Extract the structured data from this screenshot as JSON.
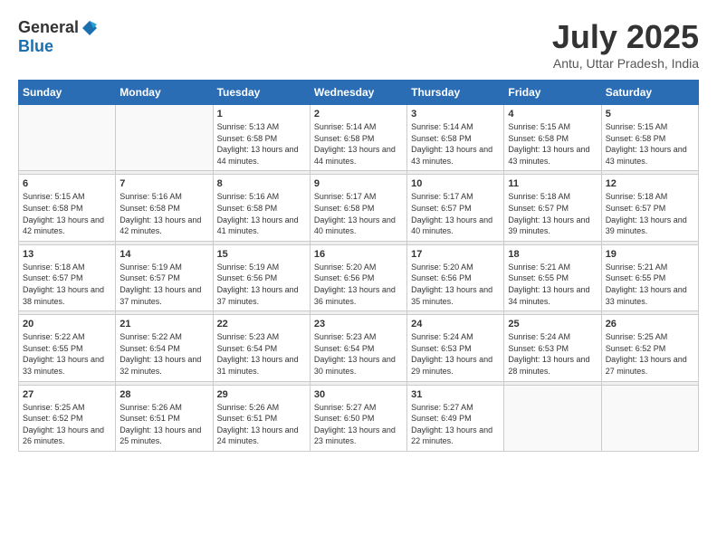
{
  "header": {
    "logo_general": "General",
    "logo_blue": "Blue",
    "month_year": "July 2025",
    "location": "Antu, Uttar Pradesh, India"
  },
  "weekdays": [
    "Sunday",
    "Monday",
    "Tuesday",
    "Wednesday",
    "Thursday",
    "Friday",
    "Saturday"
  ],
  "weeks": [
    [
      {
        "day": "",
        "sunrise": "",
        "sunset": "",
        "daylight": ""
      },
      {
        "day": "",
        "sunrise": "",
        "sunset": "",
        "daylight": ""
      },
      {
        "day": "1",
        "sunrise": "Sunrise: 5:13 AM",
        "sunset": "Sunset: 6:58 PM",
        "daylight": "Daylight: 13 hours and 44 minutes."
      },
      {
        "day": "2",
        "sunrise": "Sunrise: 5:14 AM",
        "sunset": "Sunset: 6:58 PM",
        "daylight": "Daylight: 13 hours and 44 minutes."
      },
      {
        "day": "3",
        "sunrise": "Sunrise: 5:14 AM",
        "sunset": "Sunset: 6:58 PM",
        "daylight": "Daylight: 13 hours and 43 minutes."
      },
      {
        "day": "4",
        "sunrise": "Sunrise: 5:15 AM",
        "sunset": "Sunset: 6:58 PM",
        "daylight": "Daylight: 13 hours and 43 minutes."
      },
      {
        "day": "5",
        "sunrise": "Sunrise: 5:15 AM",
        "sunset": "Sunset: 6:58 PM",
        "daylight": "Daylight: 13 hours and 43 minutes."
      }
    ],
    [
      {
        "day": "6",
        "sunrise": "Sunrise: 5:15 AM",
        "sunset": "Sunset: 6:58 PM",
        "daylight": "Daylight: 13 hours and 42 minutes."
      },
      {
        "day": "7",
        "sunrise": "Sunrise: 5:16 AM",
        "sunset": "Sunset: 6:58 PM",
        "daylight": "Daylight: 13 hours and 42 minutes."
      },
      {
        "day": "8",
        "sunrise": "Sunrise: 5:16 AM",
        "sunset": "Sunset: 6:58 PM",
        "daylight": "Daylight: 13 hours and 41 minutes."
      },
      {
        "day": "9",
        "sunrise": "Sunrise: 5:17 AM",
        "sunset": "Sunset: 6:58 PM",
        "daylight": "Daylight: 13 hours and 40 minutes."
      },
      {
        "day": "10",
        "sunrise": "Sunrise: 5:17 AM",
        "sunset": "Sunset: 6:57 PM",
        "daylight": "Daylight: 13 hours and 40 minutes."
      },
      {
        "day": "11",
        "sunrise": "Sunrise: 5:18 AM",
        "sunset": "Sunset: 6:57 PM",
        "daylight": "Daylight: 13 hours and 39 minutes."
      },
      {
        "day": "12",
        "sunrise": "Sunrise: 5:18 AM",
        "sunset": "Sunset: 6:57 PM",
        "daylight": "Daylight: 13 hours and 39 minutes."
      }
    ],
    [
      {
        "day": "13",
        "sunrise": "Sunrise: 5:18 AM",
        "sunset": "Sunset: 6:57 PM",
        "daylight": "Daylight: 13 hours and 38 minutes."
      },
      {
        "day": "14",
        "sunrise": "Sunrise: 5:19 AM",
        "sunset": "Sunset: 6:57 PM",
        "daylight": "Daylight: 13 hours and 37 minutes."
      },
      {
        "day": "15",
        "sunrise": "Sunrise: 5:19 AM",
        "sunset": "Sunset: 6:56 PM",
        "daylight": "Daylight: 13 hours and 37 minutes."
      },
      {
        "day": "16",
        "sunrise": "Sunrise: 5:20 AM",
        "sunset": "Sunset: 6:56 PM",
        "daylight": "Daylight: 13 hours and 36 minutes."
      },
      {
        "day": "17",
        "sunrise": "Sunrise: 5:20 AM",
        "sunset": "Sunset: 6:56 PM",
        "daylight": "Daylight: 13 hours and 35 minutes."
      },
      {
        "day": "18",
        "sunrise": "Sunrise: 5:21 AM",
        "sunset": "Sunset: 6:55 PM",
        "daylight": "Daylight: 13 hours and 34 minutes."
      },
      {
        "day": "19",
        "sunrise": "Sunrise: 5:21 AM",
        "sunset": "Sunset: 6:55 PM",
        "daylight": "Daylight: 13 hours and 33 minutes."
      }
    ],
    [
      {
        "day": "20",
        "sunrise": "Sunrise: 5:22 AM",
        "sunset": "Sunset: 6:55 PM",
        "daylight": "Daylight: 13 hours and 33 minutes."
      },
      {
        "day": "21",
        "sunrise": "Sunrise: 5:22 AM",
        "sunset": "Sunset: 6:54 PM",
        "daylight": "Daylight: 13 hours and 32 minutes."
      },
      {
        "day": "22",
        "sunrise": "Sunrise: 5:23 AM",
        "sunset": "Sunset: 6:54 PM",
        "daylight": "Daylight: 13 hours and 31 minutes."
      },
      {
        "day": "23",
        "sunrise": "Sunrise: 5:23 AM",
        "sunset": "Sunset: 6:54 PM",
        "daylight": "Daylight: 13 hours and 30 minutes."
      },
      {
        "day": "24",
        "sunrise": "Sunrise: 5:24 AM",
        "sunset": "Sunset: 6:53 PM",
        "daylight": "Daylight: 13 hours and 29 minutes."
      },
      {
        "day": "25",
        "sunrise": "Sunrise: 5:24 AM",
        "sunset": "Sunset: 6:53 PM",
        "daylight": "Daylight: 13 hours and 28 minutes."
      },
      {
        "day": "26",
        "sunrise": "Sunrise: 5:25 AM",
        "sunset": "Sunset: 6:52 PM",
        "daylight": "Daylight: 13 hours and 27 minutes."
      }
    ],
    [
      {
        "day": "27",
        "sunrise": "Sunrise: 5:25 AM",
        "sunset": "Sunset: 6:52 PM",
        "daylight": "Daylight: 13 hours and 26 minutes."
      },
      {
        "day": "28",
        "sunrise": "Sunrise: 5:26 AM",
        "sunset": "Sunset: 6:51 PM",
        "daylight": "Daylight: 13 hours and 25 minutes."
      },
      {
        "day": "29",
        "sunrise": "Sunrise: 5:26 AM",
        "sunset": "Sunset: 6:51 PM",
        "daylight": "Daylight: 13 hours and 24 minutes."
      },
      {
        "day": "30",
        "sunrise": "Sunrise: 5:27 AM",
        "sunset": "Sunset: 6:50 PM",
        "daylight": "Daylight: 13 hours and 23 minutes."
      },
      {
        "day": "31",
        "sunrise": "Sunrise: 5:27 AM",
        "sunset": "Sunset: 6:49 PM",
        "daylight": "Daylight: 13 hours and 22 minutes."
      },
      {
        "day": "",
        "sunrise": "",
        "sunset": "",
        "daylight": ""
      },
      {
        "day": "",
        "sunrise": "",
        "sunset": "",
        "daylight": ""
      }
    ]
  ]
}
